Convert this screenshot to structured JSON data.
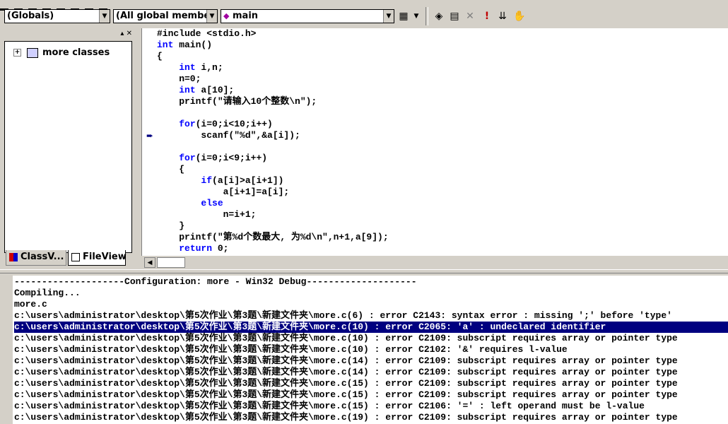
{
  "toolbar": {
    "scope_combo": "(Globals)",
    "members_combo": "(All global members",
    "function_combo": "main"
  },
  "left_pane": {
    "tree_root": "more classes",
    "tabs": [
      {
        "label": "ClassV..."
      },
      {
        "label": "FileView"
      }
    ]
  },
  "editor": {
    "code_lines": [
      [
        {
          "t": "#include <stdio.h>",
          "k": 0
        }
      ],
      [
        {
          "t": "int",
          "k": 1
        },
        {
          "t": " main()",
          "k": 0
        }
      ],
      [
        {
          "t": "{",
          "k": 0
        }
      ],
      [
        {
          "t": "    ",
          "k": 0
        },
        {
          "t": "int",
          "k": 1
        },
        {
          "t": " i,n;",
          "k": 0
        }
      ],
      [
        {
          "t": "    n=0;",
          "k": 0
        }
      ],
      [
        {
          "t": "    ",
          "k": 0
        },
        {
          "t": "int",
          "k": 1
        },
        {
          "t": " a[10];",
          "k": 0
        }
      ],
      [
        {
          "t": "    printf(\"请输入10个整数\\n\");",
          "k": 0
        }
      ],
      [
        {
          "t": "",
          "k": 0
        }
      ],
      [
        {
          "t": "    ",
          "k": 0
        },
        {
          "t": "for",
          "k": 1
        },
        {
          "t": "(i=0;i<10;i++)",
          "k": 0
        }
      ],
      [
        {
          "t": "        scanf(\"%d\",&a[i]);",
          "k": 0
        }
      ],
      [
        {
          "t": "",
          "k": 0
        }
      ],
      [
        {
          "t": "    ",
          "k": 0
        },
        {
          "t": "for",
          "k": 1
        },
        {
          "t": "(i=0;i<9;i++)",
          "k": 0
        }
      ],
      [
        {
          "t": "    {",
          "k": 0
        }
      ],
      [
        {
          "t": "        ",
          "k": 0
        },
        {
          "t": "if",
          "k": 1
        },
        {
          "t": "(a[i]>a[i+1])",
          "k": 0
        }
      ],
      [
        {
          "t": "            a[i+1]=a[i];",
          "k": 0
        }
      ],
      [
        {
          "t": "        ",
          "k": 0
        },
        {
          "t": "else",
          "k": 1
        }
      ],
      [
        {
          "t": "            n=i+1;",
          "k": 0
        }
      ],
      [
        {
          "t": "    }",
          "k": 0
        }
      ],
      [
        {
          "t": "    printf(\"第%d个数最大, 为%d\\n\",n+1,a[9]);",
          "k": 0
        }
      ],
      [
        {
          "t": "    ",
          "k": 0
        },
        {
          "t": "return",
          "k": 1
        },
        {
          "t": " 0;",
          "k": 0
        }
      ]
    ]
  },
  "output": {
    "lines": [
      "--------------------Configuration: more - Win32 Debug--------------------",
      "Compiling...",
      "more.c",
      "c:\\users\\administrator\\desktop\\第5次作业\\第3题\\新建文件夹\\more.c(6) : error C2143: syntax error : missing ';' before 'type'",
      "c:\\users\\administrator\\desktop\\第5次作业\\第3题\\新建文件夹\\more.c(10) : error C2065: 'a' : undeclared identifier",
      "c:\\users\\administrator\\desktop\\第5次作业\\第3题\\新建文件夹\\more.c(10) : error C2109: subscript requires array or pointer type",
      "c:\\users\\administrator\\desktop\\第5次作业\\第3题\\新建文件夹\\more.c(10) : error C2102: '&' requires l-value",
      "c:\\users\\administrator\\desktop\\第5次作业\\第3题\\新建文件夹\\more.c(14) : error C2109: subscript requires array or pointer type",
      "c:\\users\\administrator\\desktop\\第5次作业\\第3题\\新建文件夹\\more.c(14) : error C2109: subscript requires array or pointer type",
      "c:\\users\\administrator\\desktop\\第5次作业\\第3题\\新建文件夹\\more.c(15) : error C2109: subscript requires array or pointer type",
      "c:\\users\\administrator\\desktop\\第5次作业\\第3题\\新建文件夹\\more.c(15) : error C2109: subscript requires array or pointer type",
      "c:\\users\\administrator\\desktop\\第5次作业\\第3题\\新建文件夹\\more.c(15) : error C2106: '=' : left operand must be l-value",
      "c:\\users\\administrator\\desktop\\第5次作业\\第3题\\新建文件夹\\more.c(19) : error C2109: subscript requires array or pointer type"
    ],
    "selected_line": 4
  },
  "colors": {
    "keyword": "#0000ff",
    "selection": "#000080",
    "chrome": "#d4d0c8"
  }
}
